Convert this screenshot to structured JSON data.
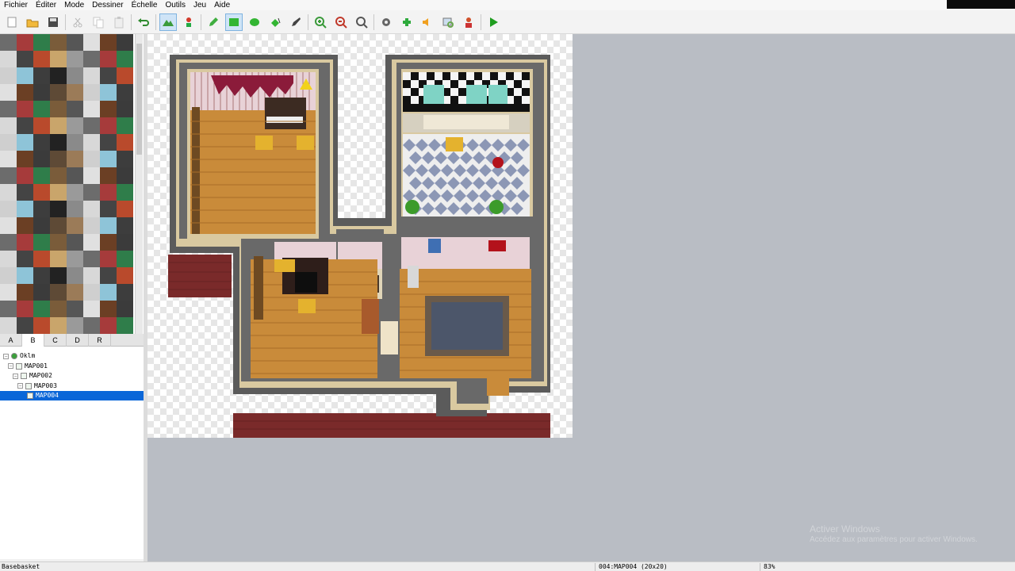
{
  "menu": [
    {
      "id": "fichier",
      "label": "Fichier"
    },
    {
      "id": "editer",
      "label": "Éditer"
    },
    {
      "id": "mode",
      "label": "Mode"
    },
    {
      "id": "dessiner",
      "label": "Dessiner"
    },
    {
      "id": "echelle",
      "label": "Échelle"
    },
    {
      "id": "outils",
      "label": "Outils"
    },
    {
      "id": "jeu",
      "label": "Jeu"
    },
    {
      "id": "aide",
      "label": "Aide"
    }
  ],
  "toolbar": [
    {
      "icon": "new-project-icon",
      "color": "#ffffff"
    },
    {
      "icon": "open-project-icon",
      "color": "#f2b93b"
    },
    {
      "icon": "save-project-icon",
      "color": "#4a4a4a"
    },
    {
      "sep": true
    },
    {
      "icon": "cut-icon",
      "color": "#b8b8b8"
    },
    {
      "icon": "copy-icon",
      "color": "#c8c8c8"
    },
    {
      "icon": "paste-icon",
      "color": "#c8c8c8"
    },
    {
      "sep": true
    },
    {
      "icon": "undo-icon",
      "color": "#2f8a2f"
    },
    {
      "sep": true
    },
    {
      "icon": "map-mode-icon",
      "color": "#3b9b3b",
      "active": true
    },
    {
      "icon": "event-mode-icon",
      "color": "#d23a2a"
    },
    {
      "sep": true
    },
    {
      "icon": "pencil-icon",
      "color": "#3fae3f"
    },
    {
      "icon": "rectangle-icon",
      "color": "#33b533",
      "active": true
    },
    {
      "icon": "ellipse-icon",
      "color": "#33b533"
    },
    {
      "icon": "flood-fill-icon",
      "color": "#33b533"
    },
    {
      "icon": "shadow-pen-icon",
      "color": "#444444"
    },
    {
      "sep": true
    },
    {
      "icon": "zoom-in-icon",
      "color": "#3a9a3a"
    },
    {
      "icon": "zoom-out-icon",
      "color": "#c0392b"
    },
    {
      "icon": "zoom-actual-icon",
      "color": "#555555"
    },
    {
      "sep": true
    },
    {
      "icon": "database-icon",
      "color": "#666666"
    },
    {
      "icon": "plugin-manager-icon",
      "color": "#2eaa3c"
    },
    {
      "icon": "sound-test-icon",
      "color": "#f0a020"
    },
    {
      "icon": "event-searcher-icon",
      "color": "#6aa84f"
    },
    {
      "icon": "character-generator-icon",
      "color": "#d0502a"
    },
    {
      "sep": true
    },
    {
      "icon": "playtest-icon",
      "color": "#1f9d1f"
    }
  ],
  "tileset_tabs": [
    {
      "id": "A",
      "label": "A"
    },
    {
      "id": "B",
      "label": "B",
      "selected": true
    },
    {
      "id": "C",
      "label": "C"
    },
    {
      "id": "D",
      "label": "D"
    },
    {
      "id": "R",
      "label": "R"
    }
  ],
  "map_tree": [
    {
      "label": "Oklm",
      "depth": 0,
      "root": true
    },
    {
      "label": "MAP001",
      "depth": 1
    },
    {
      "label": "MAP002",
      "depth": 2
    },
    {
      "label": "MAP003",
      "depth": 3
    },
    {
      "label": "MAP004",
      "depth": 4,
      "selected": true
    }
  ],
  "status": {
    "left": "Basebasket",
    "middle": "004:MAP004 (20x20)",
    "zoom": "83%"
  },
  "watermark": {
    "line1": "Activer Windows",
    "line2": "Accédez aux paramètres pour activer Windows."
  },
  "colors": {
    "selection": "#0a66d8",
    "wall": "#5b5b5b",
    "floor": "#c98b3a",
    "brick": "#7a2a2a",
    "editor_bg": "#b9bdc4"
  }
}
